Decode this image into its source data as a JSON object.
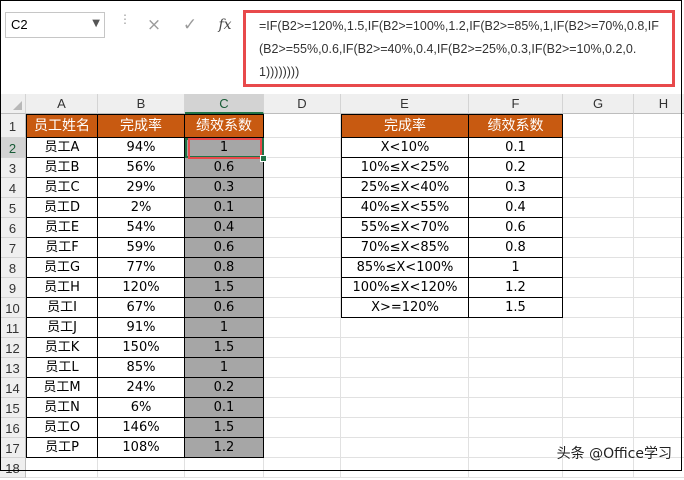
{
  "name_box": "C2",
  "formula_bar": {
    "cancel_icon": "×",
    "enter_icon": "✓",
    "fx_label": "fx",
    "formula": "=IF(B2>=120%,1.5,IF(B2>=100%,1.2,IF(B2>=85%,1,IF(B2>=70%,0.8,IF(B2>=55%,0.6,IF(B2>=40%,0.4,IF(B2>=25%,0.3,IF(B2>=10%,0.2,0.1))))))))"
  },
  "columns": [
    "A",
    "B",
    "C",
    "D",
    "E",
    "F",
    "G",
    "H"
  ],
  "rows": [
    "1",
    "2",
    "3",
    "4",
    "5",
    "6",
    "7",
    "8",
    "9",
    "10",
    "11",
    "12",
    "13",
    "14",
    "15",
    "16",
    "17",
    "18"
  ],
  "main_table": {
    "headers": [
      "员工姓名",
      "完成率",
      "绩效系数"
    ],
    "rows": [
      [
        "员工A",
        "94%",
        "1"
      ],
      [
        "员工B",
        "56%",
        "0.6"
      ],
      [
        "员工C",
        "29%",
        "0.3"
      ],
      [
        "员工D",
        "2%",
        "0.1"
      ],
      [
        "员工E",
        "54%",
        "0.4"
      ],
      [
        "员工F",
        "59%",
        "0.6"
      ],
      [
        "员工G",
        "77%",
        "0.8"
      ],
      [
        "员工H",
        "120%",
        "1.5"
      ],
      [
        "员工I",
        "67%",
        "0.6"
      ],
      [
        "员工J",
        "91%",
        "1"
      ],
      [
        "员工K",
        "150%",
        "1.5"
      ],
      [
        "员工L",
        "85%",
        "1"
      ],
      [
        "员工M",
        "24%",
        "0.2"
      ],
      [
        "员工N",
        "6%",
        "0.1"
      ],
      [
        "员工O",
        "146%",
        "1.5"
      ],
      [
        "员工P",
        "108%",
        "1.2"
      ]
    ]
  },
  "lookup_table": {
    "headers": [
      "完成率",
      "绩效系数"
    ],
    "rows": [
      [
        "X<10%",
        "0.1"
      ],
      [
        "10%≤X<25%",
        "0.2"
      ],
      [
        "25%≤X<40%",
        "0.3"
      ],
      [
        "40%≤X<55%",
        "0.4"
      ],
      [
        "55%≤X<70%",
        "0.6"
      ],
      [
        "70%≤X<85%",
        "0.8"
      ],
      [
        "85%≤X<100%",
        "1"
      ],
      [
        "100%≤X<120%",
        "1.2"
      ],
      [
        "X>=120%",
        "1.5"
      ]
    ]
  },
  "watermark": "头条 @Office学习",
  "colors": {
    "header_orange": "#c85a11",
    "highlight_red": "#e8494b",
    "selected_green": "#217346",
    "column_gray": "#a6a6a6"
  }
}
